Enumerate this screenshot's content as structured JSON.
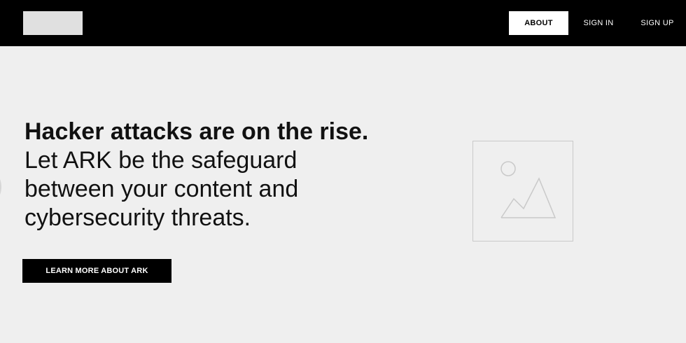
{
  "nav": {
    "about_label": "ABOUT",
    "signin_label": "SIGN IN",
    "signup_label": "SIGN UP"
  },
  "hero": {
    "headline": "Hacker attacks are on the rise.",
    "subline_1": "Let ARK be the safeguard",
    "subline_2": "between your content and",
    "subline_3": "cybersecurity threats.",
    "cta_label": "LEARN MORE ABOUT ARK"
  },
  "colors": {
    "topbar": "#000000",
    "background": "#efefef",
    "logo_placeholder": "#e0e0e0",
    "cta_background": "#000000",
    "placeholder_stroke": "#c9c9c9"
  },
  "icons": {
    "hero_image": "image-placeholder-icon"
  }
}
